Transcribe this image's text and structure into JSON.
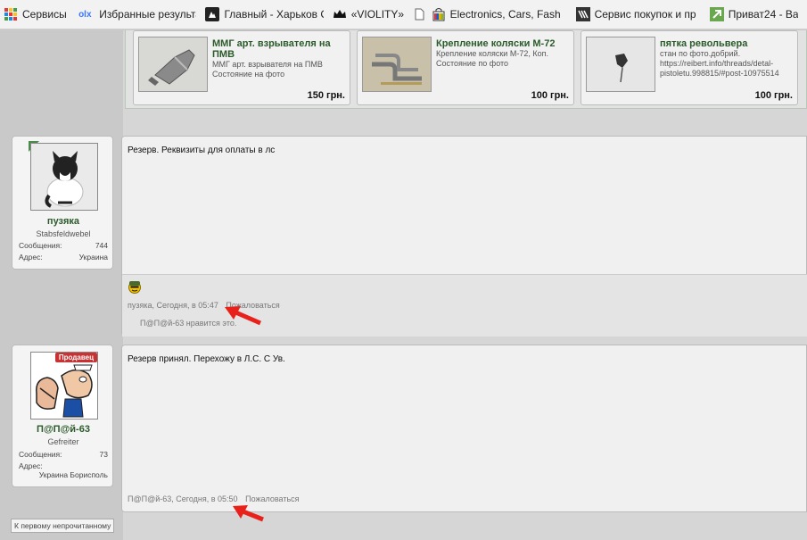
{
  "bookmarks": [
    {
      "label": "Сервисы",
      "icon": "apps-grid-icon"
    },
    {
      "label": "Избранные результа",
      "icon": "olx-icon"
    },
    {
      "label": "Главный - Харьков С",
      "icon": "photo-icon"
    },
    {
      "label": "«VIOLITY»",
      "icon": "crown-icon"
    },
    {
      "label": "Electronics, Cars, Fash",
      "icon": "ebay-bag-icon"
    },
    {
      "label": "Сервис покупок и пр",
      "icon": "shop-service-icon"
    },
    {
      "label": "Приват24 - Ва",
      "icon": "privat-icon"
    }
  ],
  "olx_label": "olx",
  "products": [
    {
      "title": "ММГ арт. взрывателя на ПМВ",
      "desc1": "ММГ арт. взрывателя на ПМВ",
      "desc2": "Состояние на фото",
      "price": "150 грн."
    },
    {
      "title": "Крепление коляски М-72",
      "desc1": "Крепление коляски М-72, Коп.",
      "desc2": "Состояние по фото",
      "price": "100 грн."
    },
    {
      "title": "пятка револьвера",
      "desc1": "стан по фото.добрий.",
      "desc2": "https://reibert.info/threads/detal-",
      "desc3": "pistoletu.998815/#post-10975514",
      "price": "100 грн."
    }
  ],
  "posts": [
    {
      "username": "пузяка",
      "user_title": "Stabsfeldwebel",
      "messages_label": "Сообщения:",
      "messages_count": "744",
      "address_label": "Адрес:",
      "address": "Украина",
      "text": "Резерв. Реквизиты для оплаты в лс",
      "meta_author": "пузяка",
      "meta_time": "Сегодня, в 05:47",
      "report": "Пожаловаться",
      "likes": "П@П@й-63 нравится это."
    },
    {
      "username": "П@П@й-63",
      "user_title": "Gefreiter",
      "badge": "Продавец",
      "messages_label": "Сообщения:",
      "messages_count": "73",
      "address_label": "Адрес:",
      "address": "Украина Борисполь",
      "text": "Резерв принял. Перехожу в Л.С. С Ув.",
      "meta_author": "П@П@й-63",
      "meta_time": "Сегодня, в 05:50",
      "report": "Пожаловаться"
    }
  ],
  "bottom_link": "К первому непрочитанному",
  "colors": {
    "accent_green": "#2b5a2b",
    "arrow_red": "#e8221b",
    "badge_red": "#c83232"
  }
}
